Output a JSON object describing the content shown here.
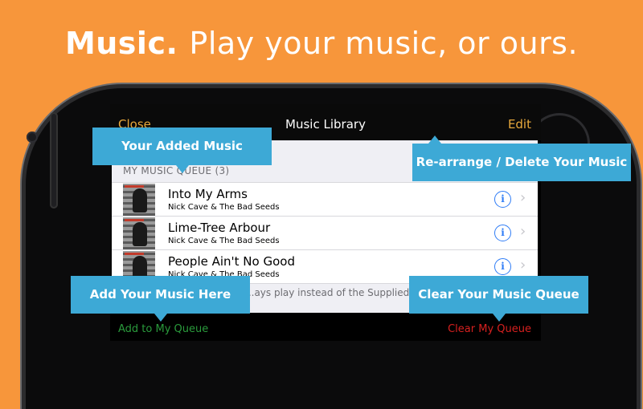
{
  "headline": {
    "bold": "Music.",
    "rest": "Play your music, or ours."
  },
  "navbar": {
    "close_label": "Close",
    "title": "Music Library",
    "edit_label": "Edit"
  },
  "queue": {
    "section_header": "MY MUSIC QUEUE (3)",
    "items": [
      {
        "title": "Into My Arms",
        "artist": "Nick Cave & The Bad Seeds"
      },
      {
        "title": "Lime-Tree Arbour",
        "artist": "Nick Cave & The Bad Seeds"
      },
      {
        "title": "People Ain't No Good",
        "artist": "Nick Cave & The Bad Seeds"
      }
    ],
    "footer_note": "...ays play instead of the Supplied C"
  },
  "toolbar": {
    "add_label": "Add to My Queue",
    "clear_label": "Clear My Queue"
  },
  "callouts": {
    "added_music": "Your Added Music",
    "rearrange": "Re-arrange / Delete Your Music",
    "add_here": "Add Your Music Here",
    "clear_queue": "Clear Your Music Queue"
  },
  "colors": {
    "background": "#F7963B",
    "nav_accent": "#E8A93C",
    "add_green": "#2A9B3C",
    "clear_red": "#D6201F",
    "callout_blue": "#3DA9D6",
    "info_blue": "#2E7CF6"
  },
  "icons": [
    "info-icon",
    "chevron-right-icon"
  ]
}
